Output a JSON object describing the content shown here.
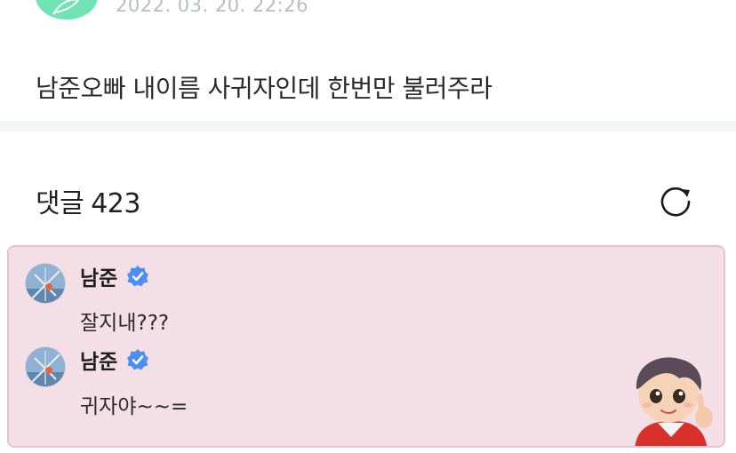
{
  "post": {
    "timestamp": "2022. 03. 20. 22:26",
    "body": "남준오빠 내이름 사귀자인데 한번만 불러주라"
  },
  "comments_section": {
    "title": "댓글",
    "count": "423"
  },
  "highlighted_comments": [
    {
      "author": "남준",
      "text": "잘지내???",
      "verified": true
    },
    {
      "author": "남준",
      "text": "귀자야~~=",
      "verified": true
    }
  ],
  "colors": {
    "highlight_background": "#f5dfe6",
    "highlight_border": "#edc0ce",
    "verified_badge": "#4c8df6",
    "author_avatar": "#6fe3b2",
    "timestamp": "#b9bcc2",
    "divider": "#f4f5f8"
  },
  "icons": {
    "refresh": "refresh-icon",
    "verified": "verified-badge-icon",
    "menu": "post-menu-icon"
  }
}
